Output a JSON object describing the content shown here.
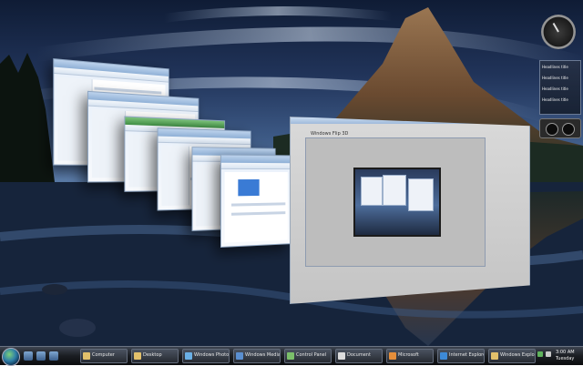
{
  "desktop": {
    "wallpaper": "mountain-lake-at-dusk",
    "colors": {
      "sky": "#3d5a86",
      "mountain": "#7a5b3e",
      "water": "#1b2a44"
    }
  },
  "flip3d": {
    "front_window": {
      "title": "Windows Flip 3D",
      "preview": "desktop-preview-thumbnail"
    },
    "stacked_windows_count": 6
  },
  "sidebar": {
    "clock_icon": "analog-clock-icon",
    "feeds": [
      "Headlines title",
      "Headlines title",
      "Headlines title",
      "Headlines title"
    ],
    "cpu_meter_icon": "cpu-meter-icon"
  },
  "taskbar": {
    "start_icon": "windows-orb-icon",
    "tasks": [
      "Computer",
      "Desktop",
      "Windows Photo",
      "Windows Media",
      "Control Panel",
      "Document",
      "Microsoft",
      "Internet Explorer",
      "Windows Explorer"
    ],
    "tray": {
      "time": "3:00 AM",
      "day": "Tuesday"
    }
  }
}
